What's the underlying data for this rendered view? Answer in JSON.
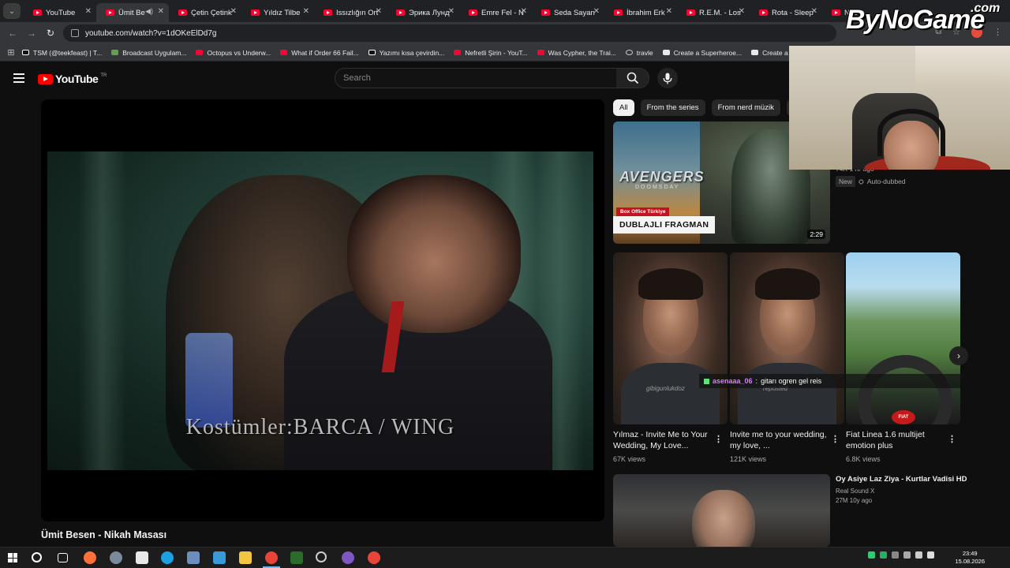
{
  "browser": {
    "tabs": [
      {
        "label": "YouTube",
        "active": false
      },
      {
        "label": "Ümit Be",
        "active": true,
        "audio": true
      },
      {
        "label": "Çetin Çetink",
        "active": false
      },
      {
        "label": "Yıldız Tilbe",
        "active": false
      },
      {
        "label": "Issızlığın Ort",
        "active": false
      },
      {
        "label": "Эрика Лунд",
        "active": false
      },
      {
        "label": "Emre Fel - N",
        "active": false
      },
      {
        "label": "Seda Sayan",
        "active": false
      },
      {
        "label": "İbrahim Erk",
        "active": false
      },
      {
        "label": "R.E.M. - Los",
        "active": false
      },
      {
        "label": "Rota - Sleep",
        "active": false
      },
      {
        "label": "Naz",
        "active": false
      }
    ],
    "url": "youtube.com/watch?v=1dOKeElDd7g",
    "bookmarks": [
      {
        "label": "TSM (@teekfeast) | T...",
        "icon": "tiktok-icon"
      },
      {
        "label": "Broadcast Uygulam...",
        "icon": "broadcast-icon"
      },
      {
        "label": "Octopus vs Underw...",
        "icon": "youtube-icon"
      },
      {
        "label": "What if Order 66 Fail...",
        "icon": "youtube-icon"
      },
      {
        "label": "Yazımı kısa çevirdin...",
        "icon": "tiktok-icon"
      },
      {
        "label": "Nefretli Şirin - YouT...",
        "icon": "youtube-icon"
      },
      {
        "label": "Was Cypher, the Trai...",
        "icon": "youtube-icon"
      },
      {
        "label": "travle",
        "icon": "globe-icon"
      },
      {
        "label": "Create a Superheroe...",
        "icon": "doc-icon"
      },
      {
        "label": "Create a Star Wars C...",
        "icon": "doc-icon"
      }
    ]
  },
  "youtube": {
    "logo_text": "YouTube",
    "country_code": "TR",
    "search_placeholder": "Search",
    "video_caption": "Kostümler:BARCA / WING",
    "video_title": "Ümit Besen - Nikah Masası",
    "chips": [
      "All",
      "From the series",
      "From nerd müzik",
      "F"
    ],
    "recommended": {
      "title_art": "AVENGERS",
      "title_art_sub": "DOOMSDAY",
      "box_office_label": "Box Office Türkiye",
      "badge_text": "DUBLAJLI FRAGMAN",
      "duration": "2:29",
      "meta": "74K  1 hr ago",
      "new_badge": "New",
      "auto_dubbed": "Auto-dubbed"
    },
    "shorts": [
      {
        "title": "Yılmaz - Invite Me to Your Wedding, My Love...",
        "views": "67K views",
        "watermark": "gibigunlukdoz"
      },
      {
        "title": "Invite me to your wedding, my love, ...",
        "views": "121K views",
        "watermark": "reposted"
      },
      {
        "title": "Fiat Linea 1.6 multijet emotion plus",
        "views": "6.8K views",
        "brand": "FIAT"
      }
    ],
    "next_video": {
      "title": "Oy Asiye Laz Ziya - Kurtlar Vadisi HD",
      "channel": "Real Sound X",
      "meta": "27M  10y ago"
    }
  },
  "chat_overlay": {
    "username": "asenaaa_06",
    "message": "gitarı ogren gel reis"
  },
  "watermark": {
    "brand": "ByNoGame",
    "suffix": ".com"
  },
  "taskbar": {
    "time": "23:49",
    "date": "15.08.2026"
  },
  "colors": {
    "youtube_red": "#ff0000",
    "background": "#0f0f0f",
    "chat_user": "#d77cff"
  }
}
